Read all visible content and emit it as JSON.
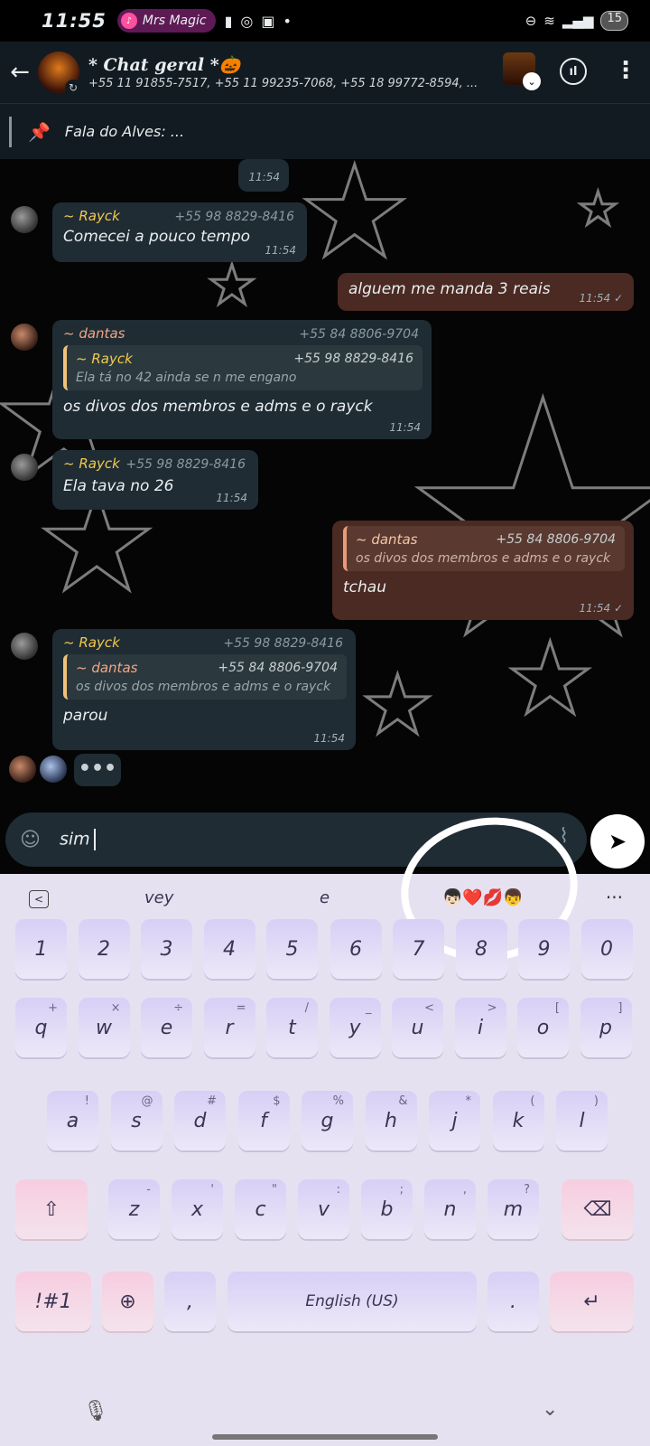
{
  "status_bar": {
    "time": "11:55",
    "media_app": "Mrs Magic",
    "battery": "15"
  },
  "header": {
    "back_icon": "arrow-left-icon",
    "title": "* Chat geral *🎃",
    "subtitle": "+55 11 91855-7517, +55 11 99235-7068, +55 18 99772-8594, ..."
  },
  "pinned": {
    "text": "Fala do Alves: ..."
  },
  "messages": [
    {
      "time": "11:54"
    },
    {
      "sender": "~ Rayck",
      "phone": "+55 98 8829-8416",
      "text": "Comecei a pouco tempo",
      "time": "11:54"
    },
    {
      "text": "alguem me manda 3 reais",
      "time": "11:54 ✓"
    },
    {
      "sender": "~ dantas",
      "phone": "+55 84 8806-9704",
      "quote": {
        "sender": "~ Rayck",
        "phone": "+55 98 8829-8416",
        "text": "Ela tá no 42 ainda se n me engano"
      },
      "text": "os divos dos membros e adms e o rayck",
      "time": "11:54"
    },
    {
      "sender": "~ Rayck",
      "phone": "+55 98 8829-8416",
      "text": "Ela tava no 26",
      "time": "11:54"
    },
    {
      "quote": {
        "sender": "~ dantas",
        "phone": "+55 84 8806-9704",
        "text": "os divos dos membros e adms e o rayck"
      },
      "text": "tchau",
      "time": "11:54 ✓"
    },
    {
      "sender": "~ Rayck",
      "phone": "+55 98 8829-8416",
      "quote": {
        "sender": "~ dantas",
        "phone": "+55 84 8806-9704",
        "text": "os divos dos membros e adms e o rayck"
      },
      "text": "parou",
      "time": "11:54"
    },
    {
      "typing": "•••"
    }
  ],
  "composer": {
    "text": "sim"
  },
  "keyboard": {
    "suggestions": [
      "vey",
      "e",
      "👦🏻❤️💋👦"
    ],
    "more": "···",
    "row_numbers": [
      "1",
      "2",
      "3",
      "4",
      "5",
      "6",
      "7",
      "8",
      "9",
      "0"
    ],
    "row1": [
      {
        "k": "q",
        "s": "+"
      },
      {
        "k": "w",
        "s": "×"
      },
      {
        "k": "e",
        "s": "÷"
      },
      {
        "k": "r",
        "s": "="
      },
      {
        "k": "t",
        "s": "/"
      },
      {
        "k": "y",
        "s": "_"
      },
      {
        "k": "u",
        "s": "<"
      },
      {
        "k": "i",
        "s": ">"
      },
      {
        "k": "o",
        "s": "["
      },
      {
        "k": "p",
        "s": "]"
      }
    ],
    "row2": [
      {
        "k": "a",
        "s": "!"
      },
      {
        "k": "s",
        "s": "@"
      },
      {
        "k": "d",
        "s": "#"
      },
      {
        "k": "f",
        "s": "$"
      },
      {
        "k": "g",
        "s": "%"
      },
      {
        "k": "h",
        "s": "&"
      },
      {
        "k": "j",
        "s": "*"
      },
      {
        "k": "k",
        "s": "("
      },
      {
        "k": "l",
        "s": ")"
      }
    ],
    "row3": [
      {
        "k": "z",
        "s": "-"
      },
      {
        "k": "x",
        "s": "'"
      },
      {
        "k": "c",
        "s": "\""
      },
      {
        "k": "v",
        "s": ":"
      },
      {
        "k": "b",
        "s": ";"
      },
      {
        "k": "n",
        "s": ","
      },
      {
        "k": "m",
        "s": "?"
      }
    ],
    "symbols_key": "!#1",
    "comma": ",",
    "space": "English (US)",
    "period": "."
  }
}
